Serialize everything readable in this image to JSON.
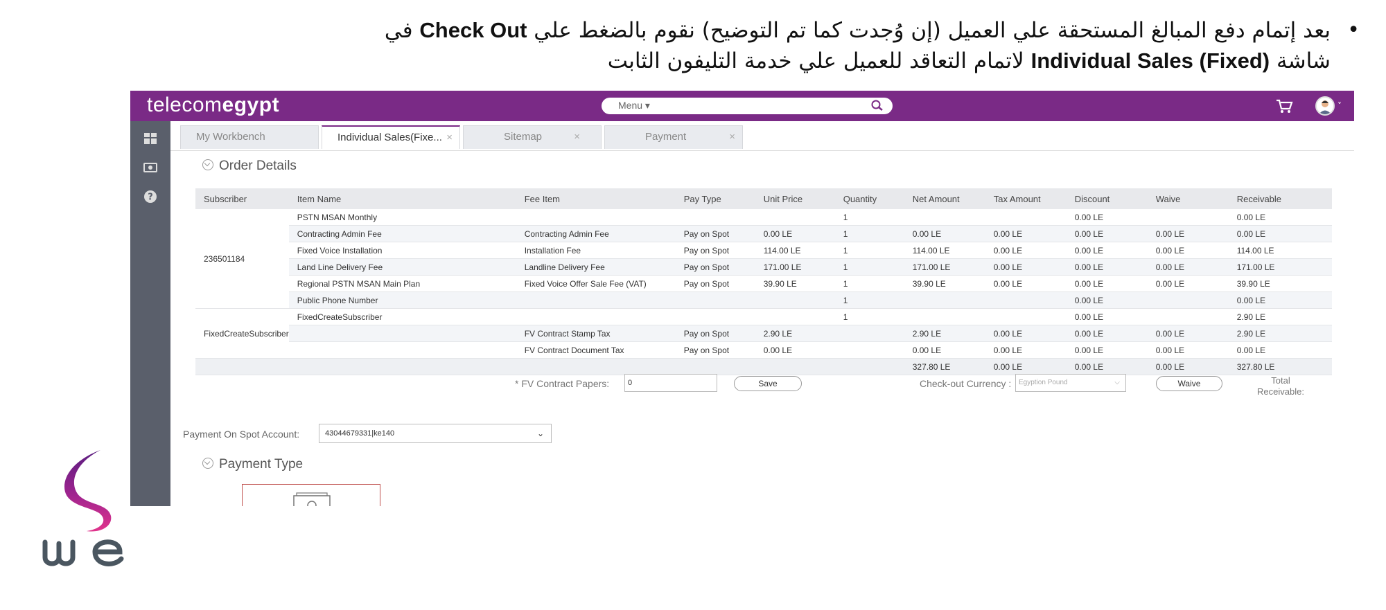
{
  "slide": {
    "bullet_line1_prefix": "بعد إتمام دفع المبالغ المستحقة علي العميل (إن وُجدت كما تم التوضيح) نقوم بالضغط علي ",
    "bullet_line1_bold": "Check Out",
    "bullet_line1_suffix": " في",
    "bullet_line2_prefix": "شاشة ",
    "bullet_line2_bold": "Individual Sales (Fixed)",
    "bullet_line2_suffix": " لاتمام التعاقد للعميل علي خدمة التليفون الثابت"
  },
  "app": {
    "logo_light": "telecom",
    "logo_bold": "egypt",
    "menu_label": "Menu ▾",
    "accent_color": "#7a2a86"
  },
  "tabs": [
    {
      "label": "My Workbench",
      "closable": false
    },
    {
      "label": "Individual Sales(Fixe...",
      "closable": true,
      "active": true
    },
    {
      "label": "Sitemap",
      "closable": true
    },
    {
      "label": "Payment",
      "closable": true
    }
  ],
  "order_details": {
    "title": "Order Details",
    "columns": [
      "Subscriber",
      "Item Name",
      "Fee Item",
      "Pay Type",
      "Unit Price",
      "Quantity",
      "Net Amount",
      "Tax Amount",
      "Discount",
      "Waive",
      "Receivable"
    ],
    "subscriber_1": "236501184",
    "subscriber_2": "FixedCreateSubscriber",
    "rows": [
      [
        "PSTN MSAN Monthly",
        "",
        "",
        "",
        "1",
        "",
        "",
        "0.00 LE",
        "",
        "0.00 LE"
      ],
      [
        "Contracting Admin Fee",
        "Contracting Admin Fee",
        "Pay on Spot",
        "0.00 LE",
        "1",
        "0.00 LE",
        "0.00 LE",
        "0.00 LE",
        "0.00 LE",
        "0.00 LE"
      ],
      [
        "Fixed Voice Installation",
        "Installation Fee",
        "Pay on Spot",
        "114.00 LE",
        "1",
        "114.00 LE",
        "0.00 LE",
        "0.00 LE",
        "0.00 LE",
        "114.00 LE"
      ],
      [
        "Land Line Delivery Fee",
        "Landline Delivery Fee",
        "Pay on Spot",
        "171.00 LE",
        "1",
        "171.00 LE",
        "0.00 LE",
        "0.00 LE",
        "0.00 LE",
        "171.00 LE"
      ],
      [
        "Regional PSTN MSAN Main Plan",
        "Fixed Voice Offer Sale Fee (VAT)",
        "Pay on Spot",
        "39.90 LE",
        "1",
        "39.90 LE",
        "0.00 LE",
        "0.00 LE",
        "0.00 LE",
        "39.90 LE"
      ],
      [
        "Public Phone Number",
        "",
        "",
        "",
        "1",
        "",
        "",
        "0.00 LE",
        "",
        "0.00 LE"
      ],
      [
        "FixedCreateSubscriber",
        "",
        "",
        "",
        "1",
        "",
        "",
        "0.00 LE",
        "",
        "2.90 LE"
      ],
      [
        "",
        "FV Contract Stamp Tax",
        "Pay on Spot",
        "2.90 LE",
        "",
        "2.90 LE",
        "0.00 LE",
        "0.00 LE",
        "0.00 LE",
        "2.90 LE"
      ],
      [
        "",
        "FV Contract Document Tax",
        "Pay on Spot",
        "0.00 LE",
        "",
        "0.00 LE",
        "0.00 LE",
        "0.00 LE",
        "0.00 LE",
        "0.00 LE"
      ]
    ],
    "totals": [
      "327.80 LE",
      "0.00 LE",
      "0.00 LE",
      "0.00 LE",
      "327.80 LE"
    ],
    "fv_papers_label": "* FV Contract Papers:",
    "fv_papers_value": "0",
    "save_label": "Save",
    "currency_label": "Check-out Currency :",
    "currency_value": "Egyption Pound",
    "waive_label": "Waive",
    "total_receivable_line1": "Total",
    "total_receivable_line2": "Receivable:"
  },
  "payment": {
    "account_label": "Payment On Spot Account:",
    "account_value": "43044679331|ke140",
    "type_title": "Payment Type"
  }
}
